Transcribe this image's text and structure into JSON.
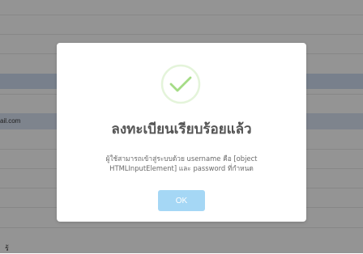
{
  "background": {
    "email_fragment": "ail.com",
    "bottom_text": "ร้"
  },
  "dialog": {
    "icon": "success-check-icon",
    "title": "ลงทะเบียนเรียบร้อยแล้ว",
    "message": "ผู้ใช้สามารถเข้าสู่ระบบด้วย username คือ [object HTMLInputElement] และ password ที่กำหนด",
    "ok_label": "OK"
  },
  "colors": {
    "success": "#a5dc86",
    "ok_button": "#a5d7f5",
    "row_highlight": "#c9d6ea"
  }
}
